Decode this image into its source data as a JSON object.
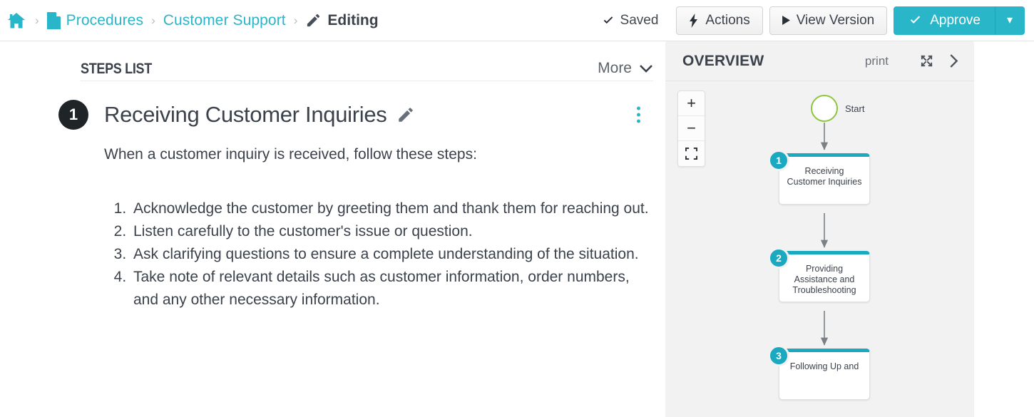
{
  "topbar": {
    "home_icon": "home-icon",
    "doc_icon": "document-icon",
    "pencil_icon": "pencil-icon",
    "separator": "›",
    "breadcrumb": [
      {
        "label": "Procedures"
      },
      {
        "label": "Customer Support"
      },
      {
        "label": "Editing"
      }
    ],
    "saved_label": "Saved",
    "saved_icon": "check-icon",
    "actions_label": "Actions",
    "actions_icon": "bolt-icon",
    "view_version_label": "View Version",
    "view_version_icon": "play-triangle-icon",
    "approve_label": "Approve",
    "approve_icon": "check-icon",
    "approve_caret": "▾",
    "accent_color": "#29b6c8"
  },
  "steps_panel": {
    "title": "STEPS LIST",
    "more_label": "More",
    "more_icon": "chevron-down-icon",
    "step": {
      "number": "1",
      "title": "Receiving Customer Inquiries",
      "edit_icon": "pencil-icon",
      "menu_icon": "kebab-menu-icon",
      "intro": "When a customer inquiry is received, follow these steps:",
      "list": [
        "Acknowledge the customer by greeting them and thank them for reaching out.",
        "Listen carefully to the customer's issue or question.",
        "Ask clarifying questions to ensure a complete understanding of the situation.",
        "Take note of relevant details such as customer information, order numbers, and any other necessary information."
      ]
    }
  },
  "overview": {
    "title": "OVERVIEW",
    "print_label": "print",
    "expand_icon": "expand-arrows-icon",
    "collapse_icon": "chevron-right-icon",
    "zoom_in": "+",
    "zoom_out": "−",
    "fit_icon": "fit-screen-icon",
    "diagram": {
      "start_label": "Start",
      "start_color": "#8cc63f",
      "node_accent": "#1aa9c0",
      "nodes": [
        {
          "number": "1",
          "label": "Receiving Customer Inquiries"
        },
        {
          "number": "2",
          "label": "Providing Assistance and Troubleshooting"
        },
        {
          "number": "3",
          "label": "Following Up and"
        }
      ]
    }
  }
}
